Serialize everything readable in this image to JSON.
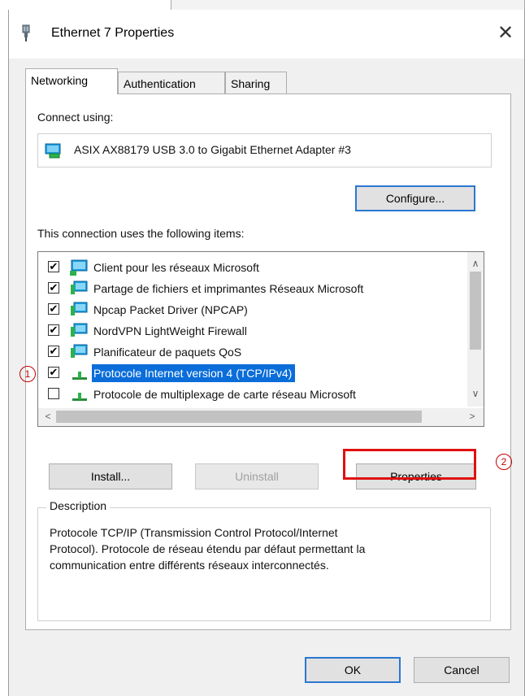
{
  "dialog": {
    "title": "Ethernet 7 Properties",
    "close_glyph": "✕"
  },
  "tabs": [
    {
      "label": "Networking",
      "active": true
    },
    {
      "label": "Authentication",
      "active": false
    },
    {
      "label": "Sharing",
      "active": false
    }
  ],
  "connect": {
    "label": "Connect using:",
    "adapter": "ASIX AX88179 USB 3.0 to Gigabit Ethernet Adapter #3",
    "configure_label": "Configure..."
  },
  "items": {
    "label": "This connection uses the following items:",
    "list": [
      {
        "text": "Client pour les réseaux Microsoft",
        "checked": true,
        "icon": "network-client-icon",
        "selected": false
      },
      {
        "text": "Partage de fichiers et imprimantes Réseaux Microsoft",
        "checked": true,
        "icon": "network-service-icon",
        "selected": false
      },
      {
        "text": "Npcap Packet Driver (NPCAP)",
        "checked": true,
        "icon": "network-service-icon",
        "selected": false
      },
      {
        "text": "NordVPN LightWeight Firewall",
        "checked": true,
        "icon": "network-service-icon",
        "selected": false
      },
      {
        "text": "Planificateur de paquets QoS",
        "checked": true,
        "icon": "network-service-icon",
        "selected": false
      },
      {
        "text": "Protocole Internet version 4 (TCP/IPv4)",
        "checked": true,
        "icon": "protocol-icon",
        "selected": true
      },
      {
        "text": "Protocole de multiplexage de carte réseau Microsoft",
        "checked": false,
        "icon": "protocol-icon",
        "selected": false
      }
    ],
    "check_glyph": "✔"
  },
  "buttons": {
    "install": "Install...",
    "uninstall": "Uninstall",
    "properties": "Properties",
    "ok": "OK",
    "cancel": "Cancel"
  },
  "description": {
    "title": "Description",
    "line1": "Protocole TCP/IP (Transmission Control Protocol/Internet",
    "line2": "Protocol). Protocole de réseau étendu par défaut permettant la",
    "line3": "communication entre différents réseaux interconnectés."
  },
  "annotations": {
    "step1": "1",
    "step2": "2"
  },
  "colors": {
    "selection": "#0a6dd9",
    "highlight": "#e01010",
    "default_button_border": "#2a77d1"
  }
}
